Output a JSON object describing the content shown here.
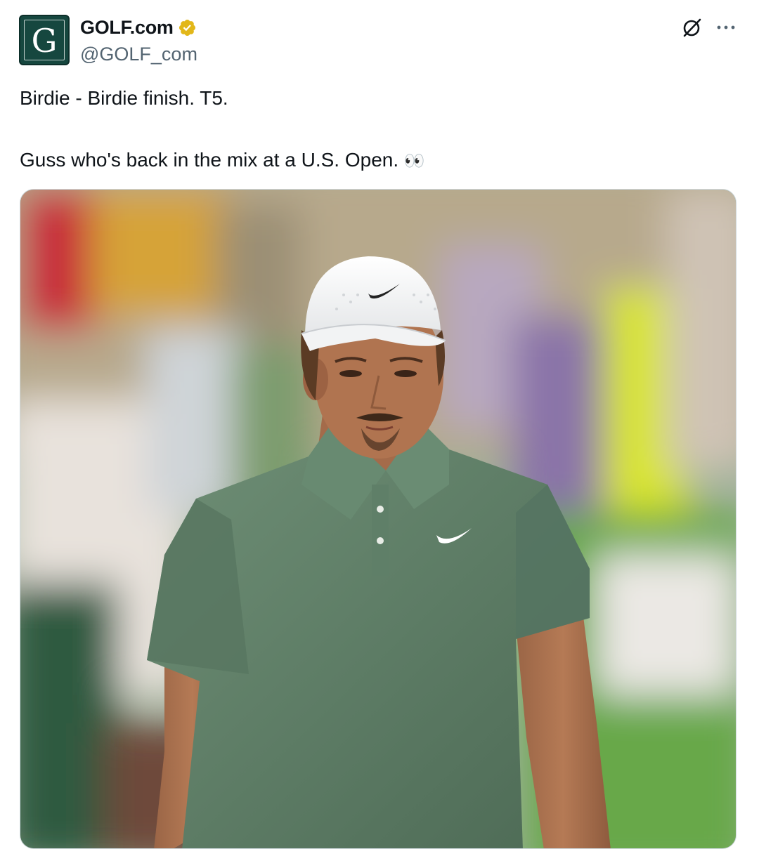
{
  "tweet": {
    "author": {
      "display_name": "GOLF.com",
      "handle": "@GOLF_com",
      "avatar_letter": "G",
      "verified": true,
      "verified_color": "#e2b719"
    },
    "text_line1": "Birdie - Birdie finish. T5.",
    "text_line2": "Guss who's back in the mix at a U.S. Open.",
    "emoji": "👀",
    "icons": {
      "grok": "grok-icon",
      "more": "more-icon",
      "verified": "verified-badge-icon"
    },
    "colors": {
      "text": "#0f1419",
      "secondary": "#536471",
      "avatar_bg": "#16473f"
    }
  }
}
